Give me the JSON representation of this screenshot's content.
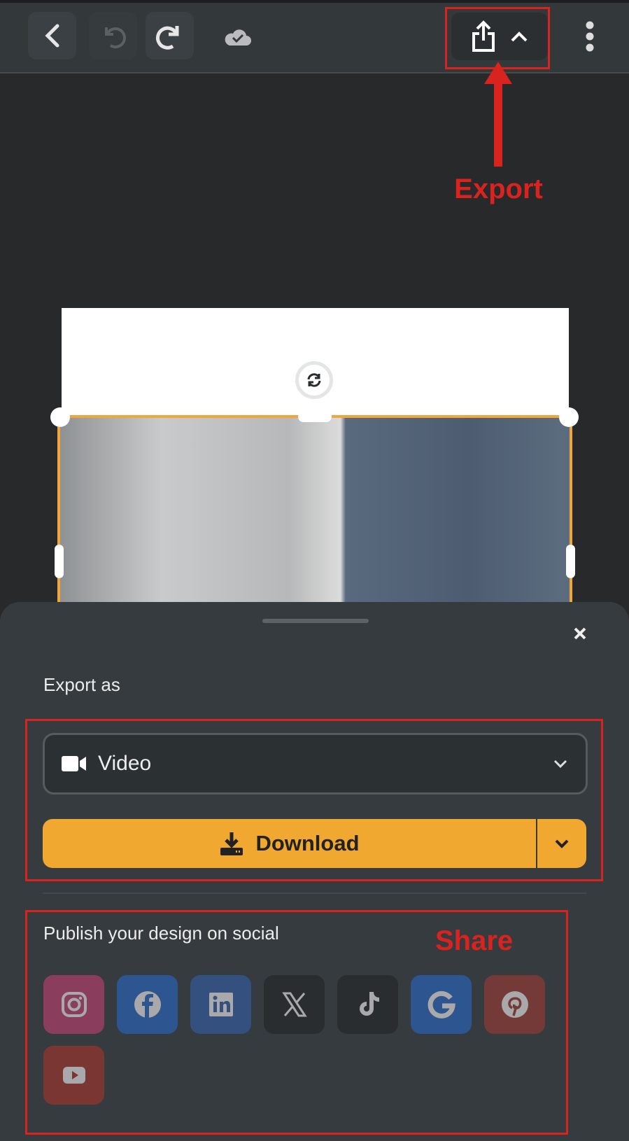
{
  "toolbar": {
    "back": "back",
    "undo": "undo",
    "redo": "redo",
    "saved": "cloud-saved"
  },
  "annotations": {
    "export_label": "Export",
    "share_label": "Share",
    "color": "#d8231f"
  },
  "sheet": {
    "title": "Export as",
    "format_value": "Video",
    "download_label": "Download",
    "publish_label": "Publish your design on social",
    "accent": "#f0a830",
    "socials": [
      {
        "name": "instagram",
        "color": "#8a3d5c"
      },
      {
        "name": "facebook",
        "color": "#2d5590"
      },
      {
        "name": "linkedin",
        "color": "#33507e"
      },
      {
        "name": "x",
        "color": "#2a2d2f"
      },
      {
        "name": "tiktok",
        "color": "#2a2d2f"
      },
      {
        "name": "google",
        "color": "#2d5590"
      },
      {
        "name": "pinterest",
        "color": "#733a38"
      },
      {
        "name": "youtube",
        "color": "#7a3632"
      }
    ]
  }
}
